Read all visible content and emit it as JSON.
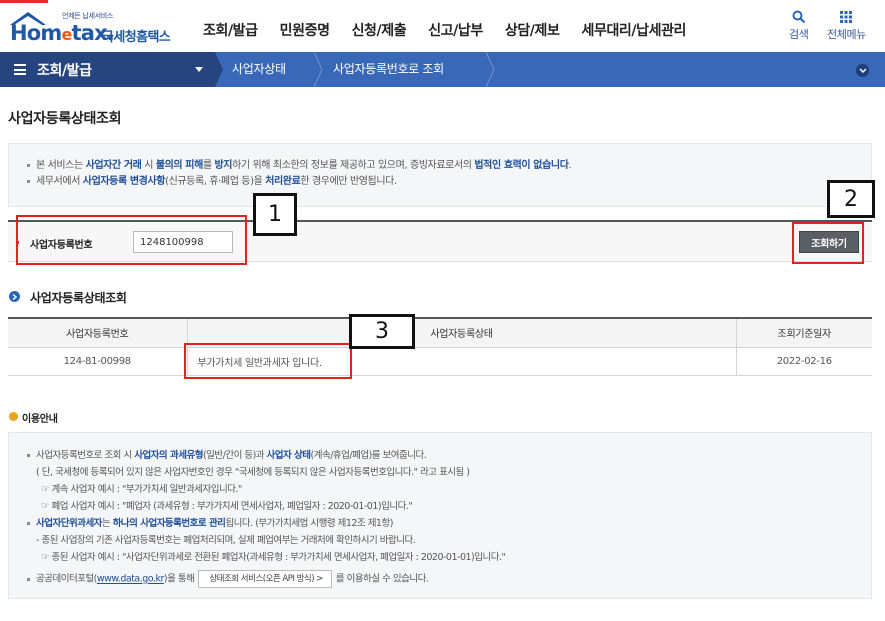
{
  "header": {
    "logo_small": "언제든 납세서비스",
    "logo_main_1": "Hom",
    "logo_main_e": "e",
    "logo_main_2": "tax.",
    "logo_kor": "국세청홈택스",
    "menu": [
      "조회/발급",
      "민원증명",
      "신청/제출",
      "신고/납부",
      "상담/제보",
      "세무대리/납세관리"
    ],
    "search_label": "검색",
    "allmenu_label": "전체메뉴"
  },
  "nav": {
    "current": "조회/발급",
    "crumbs": [
      "사업자상태",
      "사업자등록번호로 조회"
    ]
  },
  "page_title": "사업자등록상태조회",
  "notice": {
    "line1_a": "본 서비스는 ",
    "line1_b": "사업자간 거래",
    "line1_c": " 시 ",
    "line1_d": "불의의 피해",
    "line1_e": "를 ",
    "line1_f": "방지",
    "line1_g": "하기 위해 최소한의 정보를 제공하고 있으며, 증빙자료로서의 ",
    "line1_h": "법적인 효력이 없습니다",
    "line1_i": ".",
    "line2_a": "세무서에서 ",
    "line2_b": "사업자등록 변경사항",
    "line2_c": "(신규등록, 휴·폐업 등)을 ",
    "line2_d": "처리완료",
    "line2_e": "한 경우에만 반영됩니다."
  },
  "search": {
    "label": "사업자등록번호",
    "value": "1248100998",
    "button": "조회하기"
  },
  "result": {
    "title": "사업자등록상태조회",
    "columns": [
      "사업자등록번호",
      "사업자등록상태",
      "조회기준일자"
    ],
    "rows": [
      {
        "number": "124-81-00998",
        "status": "부가가치세 일반과세자 입니다.",
        "date": "2022-02-16"
      }
    ]
  },
  "info": {
    "title": "이용안내",
    "l1_a": "사업자등록번호로 조회 시 ",
    "l1_b": "사업자의 과세유형",
    "l1_c": "(일반/간이 등)과 ",
    "l1_d": "사업자 상태",
    "l1_e": "(계속/휴업/폐업)를 보여줍니다.",
    "l2": "( 단, 국세청에 등록되어 있지 않은 사업자번호인 경우 \"국세청에 등록되지 않은 사업자등록번호입니다.\" 라고 표시됨 )",
    "l3": "☞ 계속 사업자 예시 : \"부가가치세 일반과세자입니다.\"",
    "l4": "☞ 폐업 사업자 예시 : \"폐업자 (과세유형 : 부가가치세 면세사업자, 폐업일자 : 2020-01-01)입니다.\"",
    "l5_a": "사업자단위과세자",
    "l5_b": "는 ",
    "l5_c": "하나의 사업자등록번호로 관리",
    "l5_d": "됩니다. (부가가치세법 시행령 제12조 제1항)",
    "l6": "- 종된 사업장의 기존 사업자등록번호는 폐업처리되며, 실제 폐업여부는 거래처에 확인하시기 바랍니다.",
    "l7": "☞ 종된 사업자 예시 : \"사업자단위과세로 전환된 폐업자(과세유형 : 부가가치세 면세사업자, 폐업일자 : 2020-01-01)입니다.\"",
    "l8_a": "공공데이터포털(",
    "l8_link": "www.data.go.kr",
    "l8_b": ")을 통해",
    "l8_btn": "상태조회 서비스(오픈 API 방식)  >",
    "l8_c": "를 이용하실 수 있습니다."
  },
  "annotations": [
    "1",
    "2",
    "3"
  ]
}
